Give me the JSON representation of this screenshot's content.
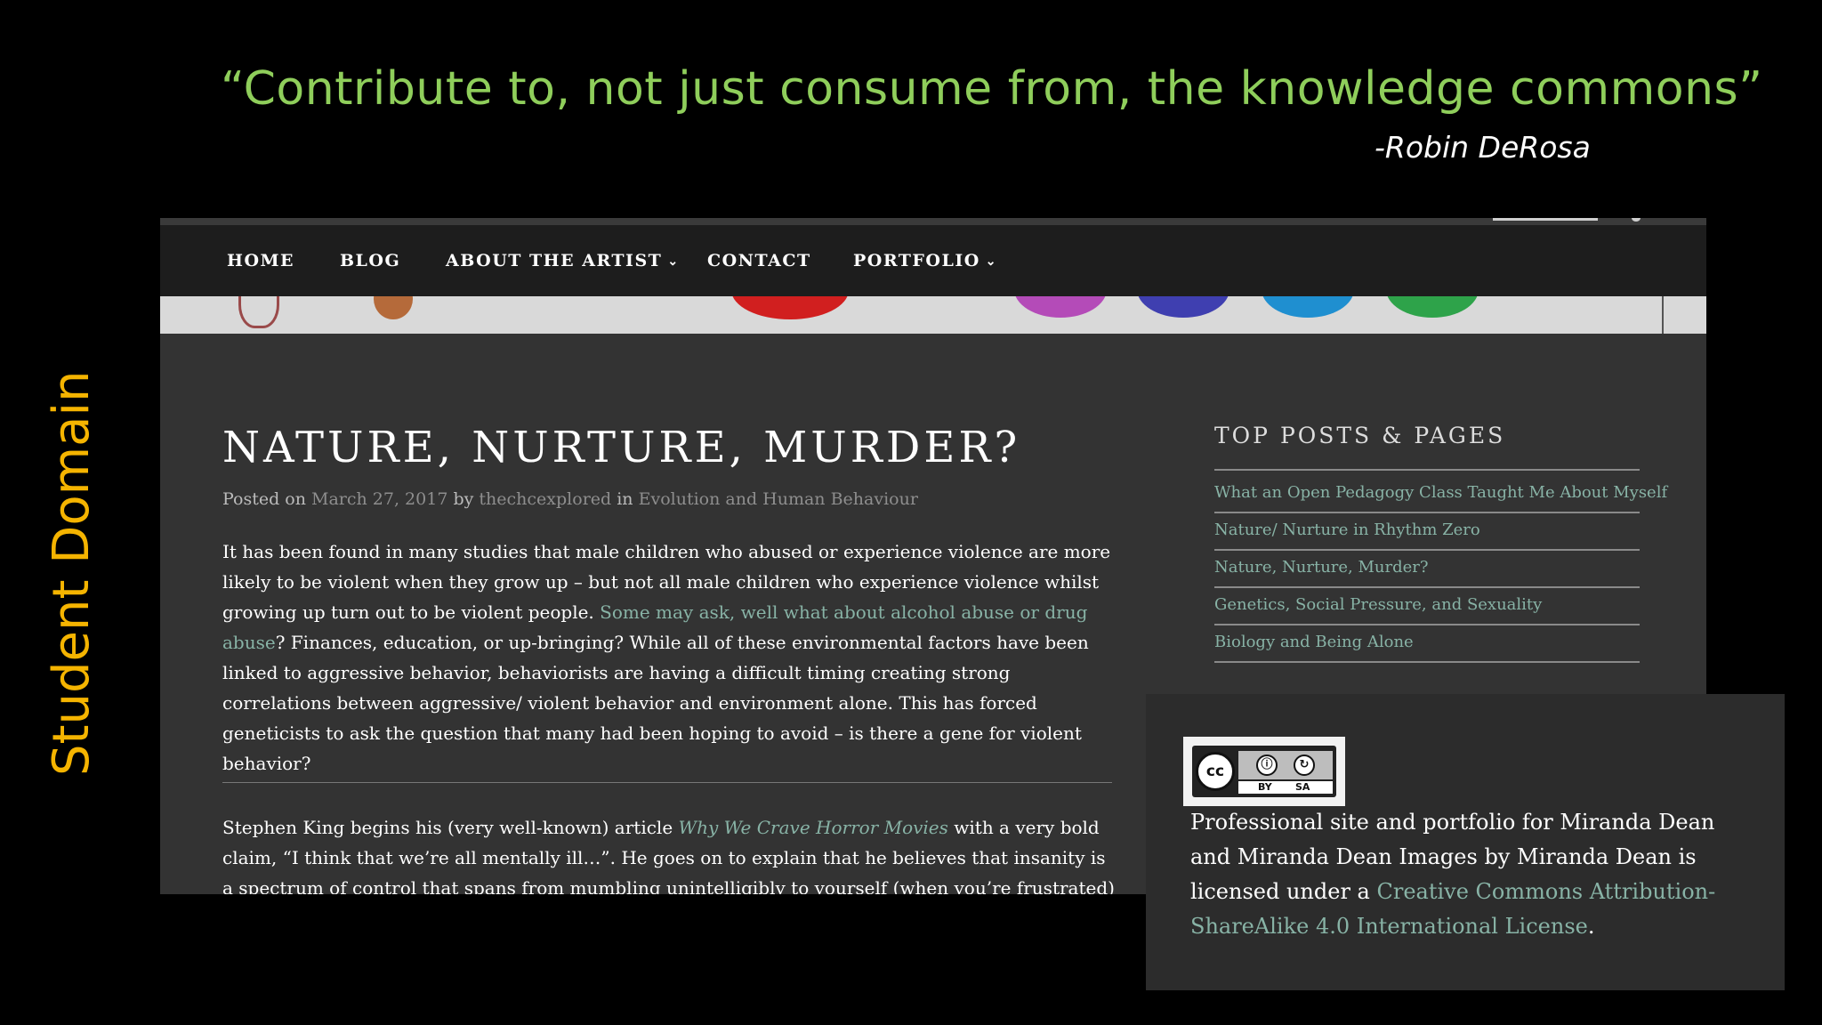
{
  "slide": {
    "quote": "“Contribute to, not just consume from, the knowledge commons”",
    "attribution": "-Robin DeRosa",
    "side_label": "Student Domain",
    "colors": {
      "quote": "#8fce5b",
      "side_label": "#f5b400",
      "background": "#000000"
    }
  },
  "site": {
    "nav": {
      "home": "HOME",
      "blog": "BLOG",
      "about": "ABOUT THE ARTIST",
      "contact": "CONTACT",
      "portfolio": "PORTFOLIO"
    },
    "post": {
      "title": "NATURE, NURTURE, MURDER?",
      "meta": {
        "posted_on": "Posted on",
        "date": "March 27, 2017",
        "by": "by",
        "author": "thechcexplored",
        "in": "in",
        "category": "Evolution and Human Behaviour"
      },
      "para1_a": "It has been found in many studies that male children who abused or experience violence are more likely to be violent when they grow up – but not all male children who experience violence whilst growing up turn out to be violent people. ",
      "para1_link": "Some may ask, well what about alcohol abuse or drug abuse",
      "para1_b": "? Finances, education, or up-bringing? While all of these environmental factors have been linked to aggressive behavior, behaviorists are having a difficult timing creating strong correlations between aggressive/ violent behavior and environment alone. This has forced geneticists to ask the question that many had been hoping to avoid – is there a gene for violent behavior?",
      "para2_a": "Stephen King begins his (very well-known) article ",
      "para2_link": "Why We Crave Horror Movies",
      "para2_b": " with a very bold claim, “I think that we’re all mentally ill…”. He goes on to explain that he believes that insanity is a spectrum of control that spans from mumbling unintelligibly to yourself (when you’re frustrated) to cutting off"
    },
    "sidebar": {
      "title": "TOP POSTS & PAGES",
      "items": [
        "What an Open Pedagogy Class Taught Me About Myself",
        "Nature/ Nurture in Rhythm Zero",
        "Nature, Nurture, Murder?",
        "Genetics, Social Pressure, and Sexuality",
        "Biology and Being Alone"
      ]
    },
    "colors": {
      "link": "#88b3a6",
      "panel": "#333333",
      "nav": "#1d1d1d"
    }
  },
  "license": {
    "badge": {
      "cc": "cc",
      "by": "BY",
      "sa": "SA"
    },
    "text_a": "Professional site and portfolio for Miranda Dean and Miranda Dean Images by Miranda Dean is licensed under a ",
    "link": "Creative Commons Attribution-ShareAlike 4.0 International License",
    "text_b": "."
  }
}
